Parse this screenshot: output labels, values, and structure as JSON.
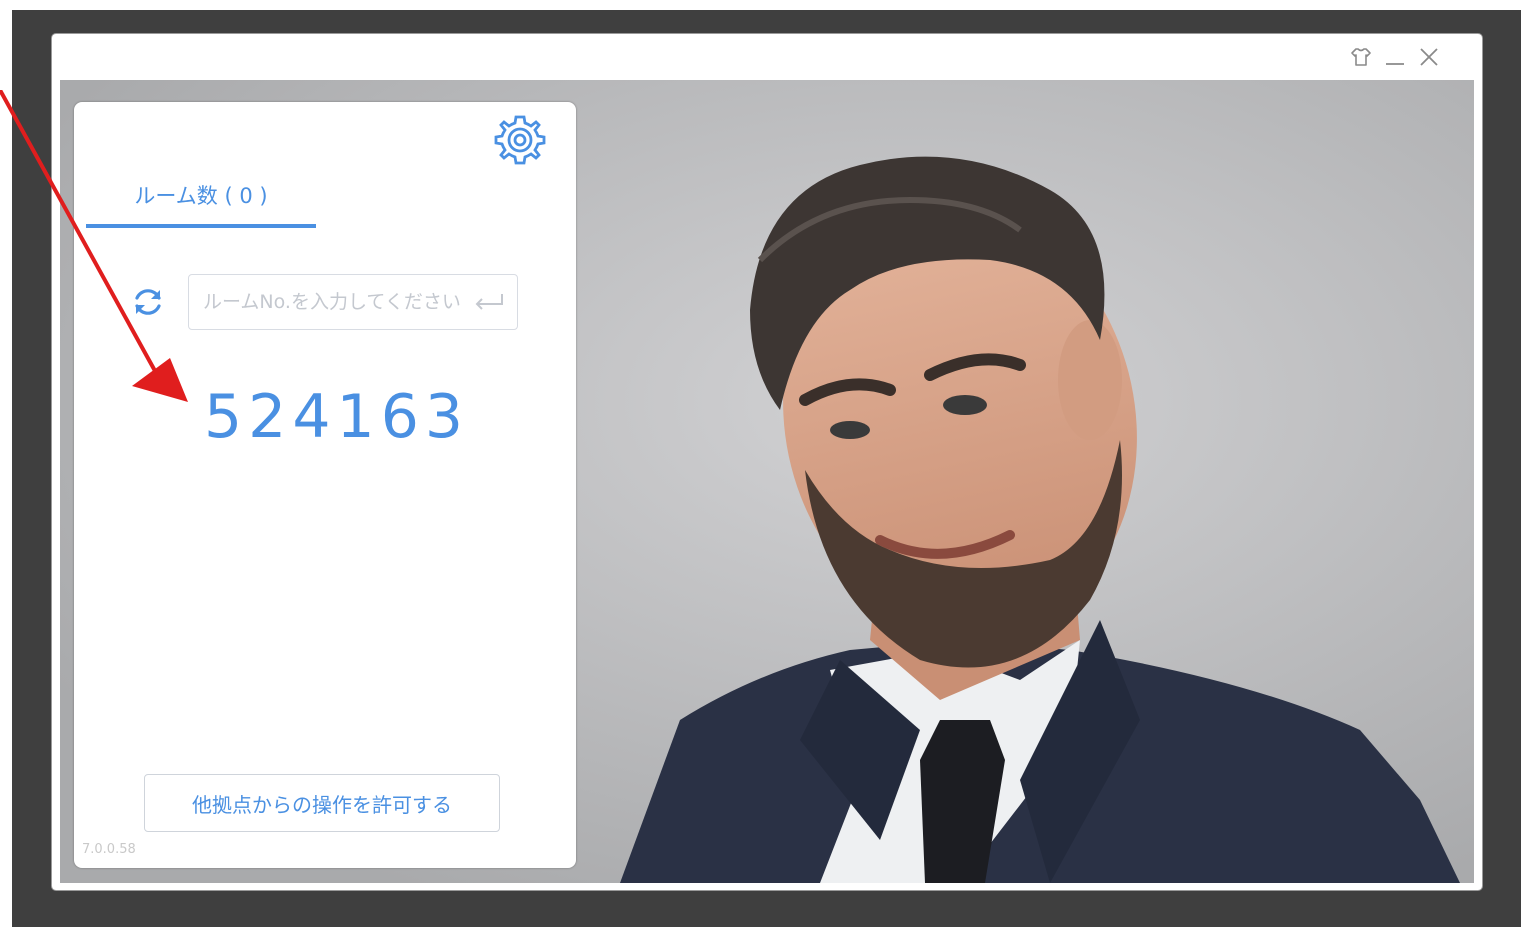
{
  "window": {
    "controls": [
      {
        "name": "skin-icon",
        "label": "skin"
      },
      {
        "name": "minimize-icon",
        "label": "minimize"
      },
      {
        "name": "close-icon",
        "label": "close"
      }
    ]
  },
  "panel": {
    "tab_label": "ルーム数 ( 0 )",
    "search_placeholder": "ルームNo.を入力してください",
    "room_number": "524163",
    "allow_button_label": "他拠点からの操作を許可する",
    "version": "7.0.0.58"
  },
  "colors": {
    "accent": "#4a90e2",
    "annotation_arrow": "#e01e1e",
    "backdrop": "#3f3f3f"
  }
}
